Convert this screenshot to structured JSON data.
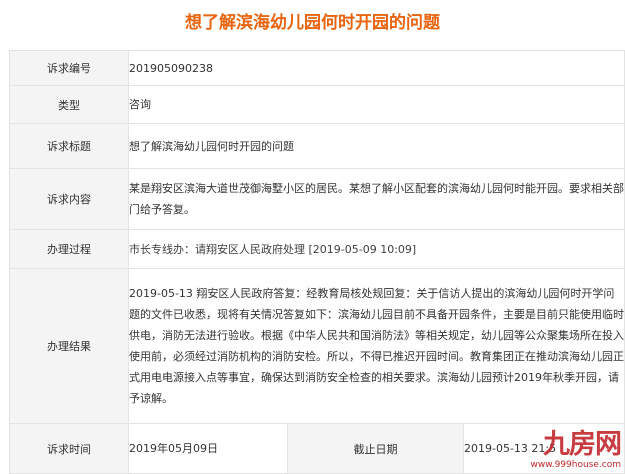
{
  "page": {
    "title": "想了解滨海幼儿园何时开园的问题"
  },
  "rows": {
    "number": {
      "label": "诉求编号",
      "value": "201905090238"
    },
    "type": {
      "label": "类型",
      "value": "咨询"
    },
    "subject": {
      "label": "诉求标题",
      "value": "想了解滨海幼儿园何时开园的问题"
    },
    "content": {
      "label": "诉求内容",
      "value": "某是翔安区滨海大道世茂御海墅小区的居民。某想了解小区配套的滨海幼儿园何时能开园。要求相关部门给予答复。"
    },
    "process": {
      "label": "办理过程",
      "value": "市长专线办：请翔安区人民政府处理 [2019-05-09 10:09]"
    },
    "result": {
      "label": "办理结果",
      "value": "2019-05-13 翔安区人民政府答复：经教育局核处规回复：关于信访人提出的滨海幼儿园何时开学问题的文件已收悉，现将有关情况答复如下：滨海幼儿园目前不具备开园条件，主要是目前只能使用临时供电，消防无法进行验收。根据《中华人民共和国消防法》等相关规定，幼儿园等公众聚集场所在投入使用前，必须经过消防机构的消防安检。所以，不得已推迟开园时间。教育集团正在推动滨海幼儿园正式用电电源接入点等事宜，确保达到消防安全检查的相关要求。滨海幼儿园预计2019年秋季开园，请予谅解。"
    },
    "time": {
      "label": "诉求时间",
      "value": "2019年05月09日",
      "deadline_label": "截止日期",
      "deadline_value": "2019-05-13 21:5"
    }
  },
  "watermark": {
    "brand": "九房网",
    "url": "www.999house.com"
  },
  "colors": {
    "title": "#e8640f",
    "label_bg": "#f4f4f4",
    "border": "#e3e3e3",
    "watermark": "#c0272d"
  }
}
